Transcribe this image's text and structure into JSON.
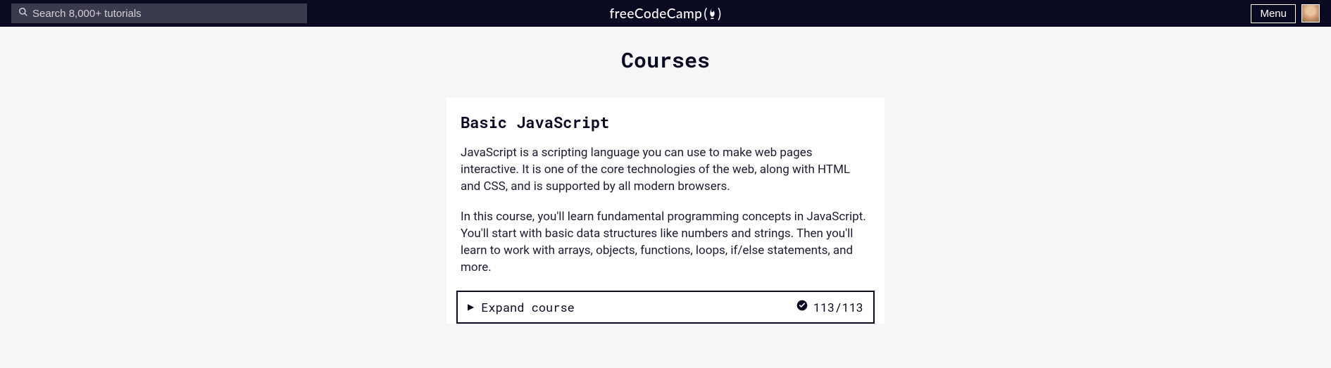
{
  "header": {
    "search_placeholder": "Search 8,000+ tutorials",
    "logo_text": "freeCodeCamp",
    "menu_label": "Menu"
  },
  "page": {
    "title": "Courses"
  },
  "course": {
    "title": "Basic JavaScript",
    "description_1": "JavaScript is a scripting language you can use to make web pages interactive. It is one of the core technologies of the web, along with HTML and CSS, and is supported by all modern browsers.",
    "description_2": "In this course, you'll learn fundamental programming concepts in JavaScript. You'll start with basic data structures like numbers and strings. Then you'll learn to work with arrays, objects, functions, loops, if/else statements, and more.",
    "expand_label": "Expand course",
    "progress": "113/113"
  }
}
